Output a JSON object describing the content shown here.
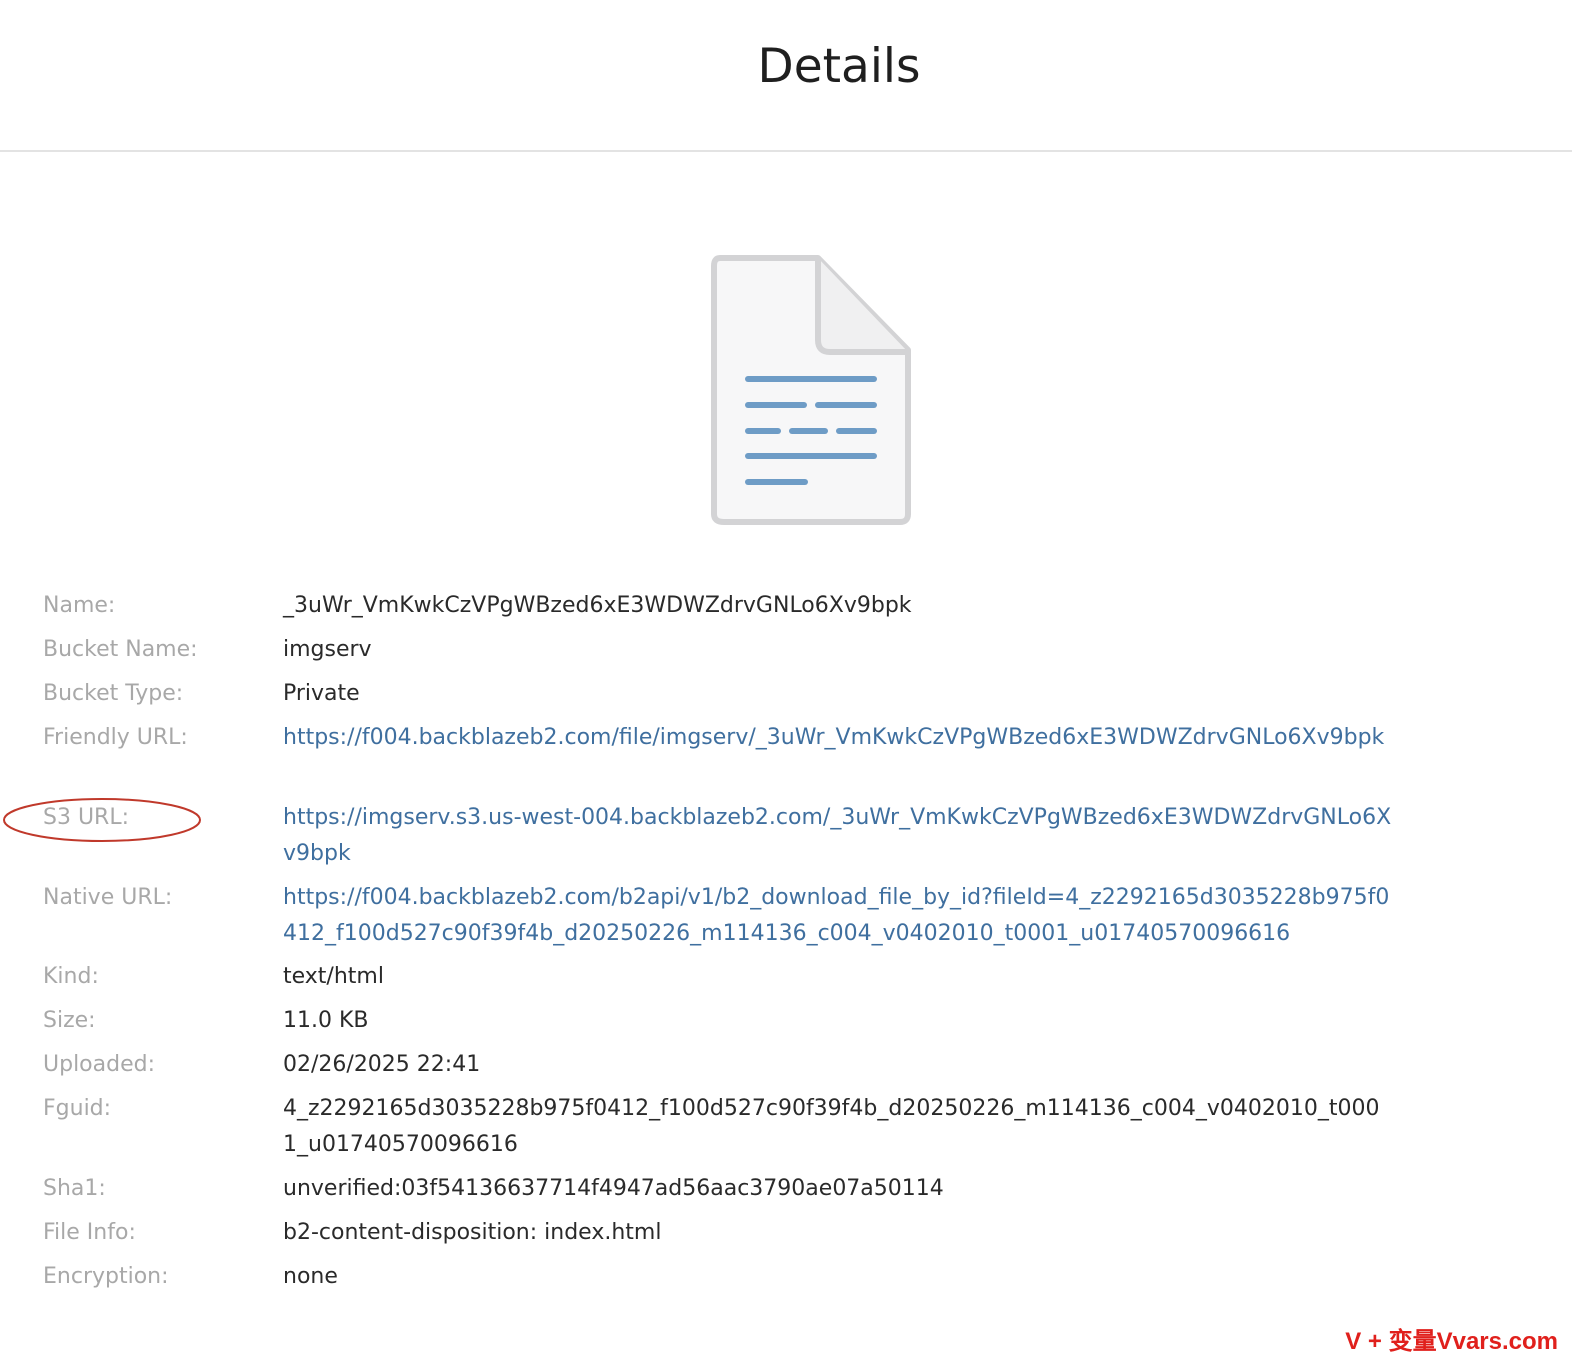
{
  "header": {
    "title": "Details"
  },
  "preview": {
    "icon": "document-icon"
  },
  "details": {
    "name": {
      "label": "Name:",
      "value": "_3uWr_VmKwkCzVPgWBzed6xE3WDWZdrvGNLo6Xv9bpk"
    },
    "bucket_name": {
      "label": "Bucket Name:",
      "value": "imgserv"
    },
    "bucket_type": {
      "label": "Bucket Type:",
      "value": "Private"
    },
    "friendly_url": {
      "label": "Friendly URL:",
      "value": "https://f004.backblazeb2.com/file/imgserv/_3uWr_VmKwkCzVPgWBzed6xE3WDWZdrvGNLo6Xv9bpk"
    },
    "s3_url": {
      "label": "S3 URL:",
      "value": "https://imgserv.s3.us-west-004.backblazeb2.com/_3uWr_VmKwkCzVPgWBzed6xE3WDWZdrvGNLo6Xv9bpk"
    },
    "native_url": {
      "label": "Native URL:",
      "value": "https://f004.backblazeb2.com/b2api/v1/b2_download_file_by_id?fileId=4_z2292165d3035228b975f0412_f100d527c90f39f4b_d20250226_m114136_c004_v0402010_t0001_u01740570096616"
    },
    "kind": {
      "label": "Kind:",
      "value": "text/html"
    },
    "size": {
      "label": "Size:",
      "value": "11.0 KB"
    },
    "uploaded": {
      "label": "Uploaded:",
      "value": "02/26/2025 22:41"
    },
    "fguid": {
      "label": "Fguid:",
      "value": "4_z2292165d3035228b975f0412_f100d527c90f39f4b_d20250226_m114136_c004_v0402010_t0001_u01740570096616"
    },
    "sha1": {
      "label": "Sha1:",
      "value": "unverified:03f54136637714f4947ad56aac3790ae07a50114"
    },
    "file_info": {
      "label": "File Info:",
      "value": "b2-content-disposition: index.html"
    },
    "encryption": {
      "label": "Encryption:",
      "value": "none"
    }
  },
  "annotation": {
    "color": "#c0392b",
    "target": "s3_url"
  },
  "watermark": {
    "text": "V + 变量Vvars.com"
  },
  "colors": {
    "link": "#3f6f9f",
    "label": "#a8a8a8",
    "value": "#2a2a2a",
    "icon_lines": "#6e9cc6"
  }
}
